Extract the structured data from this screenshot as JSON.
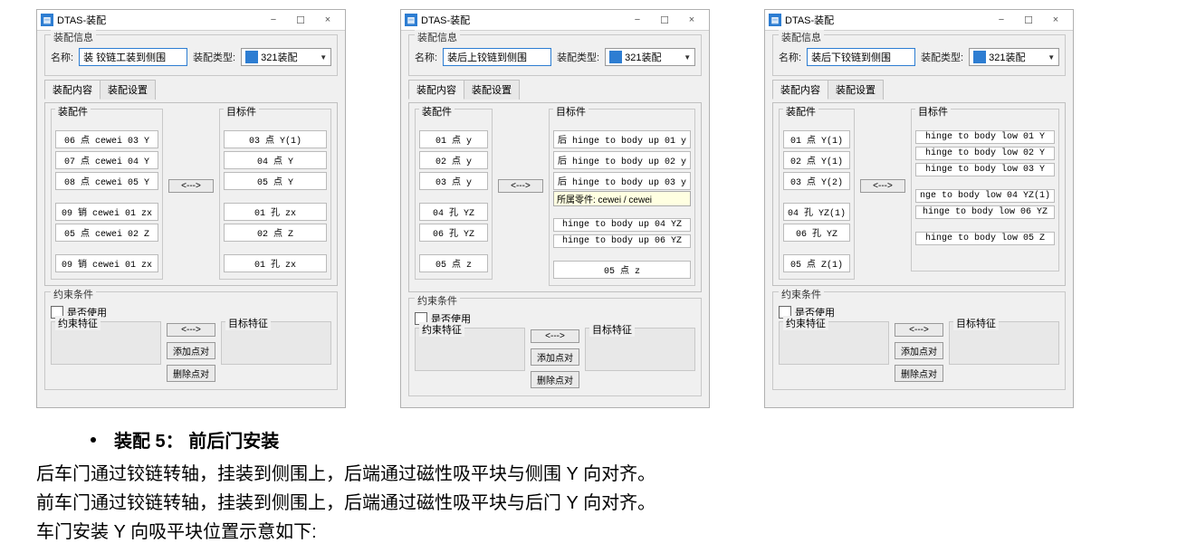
{
  "window_title": "DTAS-装配",
  "titlebar_min": "−",
  "titlebar_max": "☐",
  "titlebar_close": "×",
  "group_info_title": "装配信息",
  "label_name": "名称:",
  "label_type": "装配类型:",
  "type_value": "321装配",
  "tab_content": "装配内容",
  "tab_settings": "装配设置",
  "sub_left_title": "装配件",
  "sub_right_title": "目标件",
  "mid_button": "<--->",
  "group_constraint_title": "约束条件",
  "chk_label": "是否使用",
  "constraint_left_title": "约束特征",
  "constraint_right_title": "目标特征",
  "btn_add": "添加点对",
  "btn_del": "删除点对",
  "dialogs": [
    {
      "name_value": "装 铰链工装到侧围",
      "left_items": [
        "06 点 cewei 03 Y",
        "07 点 cewei 04 Y",
        "08 点 cewei 05 Y",
        "",
        "09 销 cewei 01 zx",
        "05 点 cewei 02 Z",
        "",
        "09 销 cewei 01 zx"
      ],
      "right_items": [
        "03 点 Y(1)",
        "04 点 Y",
        "05 点 Y",
        "",
        "01 孔 zx",
        "02 点 Z",
        "",
        "01 孔 zx"
      ],
      "tooltip": ""
    },
    {
      "name_value": "装后上铰链到侧围",
      "left_items": [
        "01 点 y",
        "02 点 y",
        "03 点 y",
        "",
        "04 孔 YZ",
        "06 孔 YZ",
        "",
        "05 点 z"
      ],
      "right_items": [
        "后 hinge to body up 01 y",
        "后 hinge to body up 02 y",
        "后 hinge to body up 03 y",
        "",
        "hinge to body up 04 YZ",
        "hinge to body up 06 YZ",
        "",
        "05 点 z"
      ],
      "tooltip": "所属零件: cewei / cewei"
    },
    {
      "name_value": "装后下铰链到侧围",
      "left_items": [
        "01 点 Y(1)",
        "02 点 Y(1)",
        "03 点 Y(2)",
        "",
        "04 孔 YZ(1)",
        "06 孔 YZ",
        "",
        "05 点 Z(1)"
      ],
      "right_items": [
        "hinge to body low 01 Y",
        "hinge to body low 02 Y",
        "hinge to body low 03 Y",
        "",
        "nge to body low 04 YZ(1)",
        "hinge to body low 06 YZ",
        "",
        "hinge to body low 05 Z"
      ],
      "tooltip": ""
    }
  ],
  "prose": {
    "bullet": "装配 5：  前后门安装",
    "p1": "后车门通过铰链转轴，挂装到侧围上，后端通过磁性吸平块与侧围 Y 向对齐。",
    "p2": "前车门通过铰链转轴，挂装到侧围上，后端通过磁性吸平块与后门 Y 向对齐。",
    "p3": "车门安装 Y 向吸平块位置示意如下:"
  }
}
